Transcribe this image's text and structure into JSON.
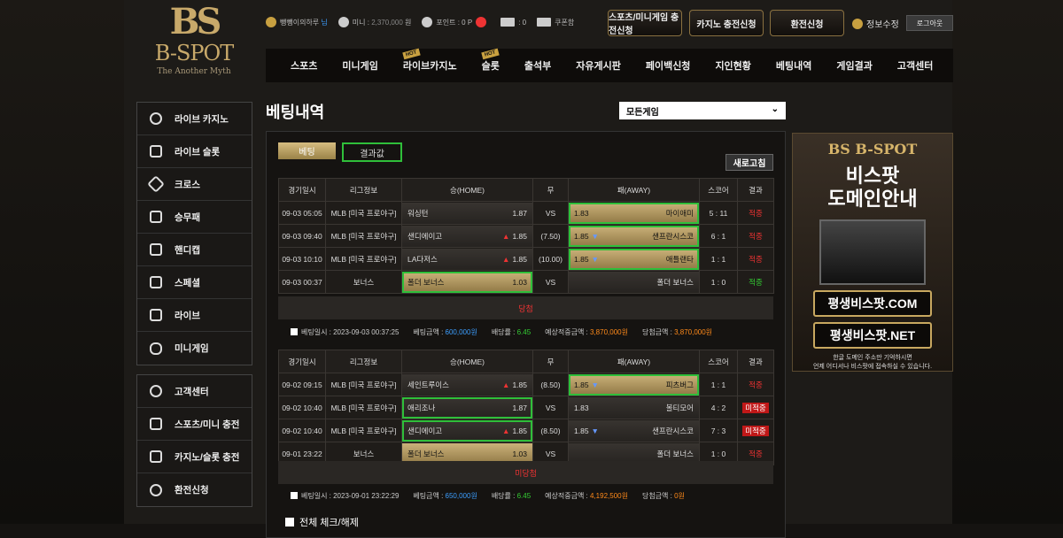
{
  "logo": {
    "mark": "BS",
    "name": "B-SPOT",
    "tagline": "The Another Myth"
  },
  "top": {
    "greet_name": "뺑뺑이의하루",
    "greet_suffix": "님",
    "mini_label": "미니 :",
    "mini_value": "2,370,000",
    "mini_unit": "원",
    "point_label": "포인트 :",
    "point_value": "0",
    "point_unit": "P",
    "msg_count": "0",
    "coupon": "쿠폰함",
    "btn1": "스포츠/미니게임 충전신청",
    "btn2": "카지노 충전신청",
    "btn3": "환전신청",
    "profile": "정보수정",
    "logout": "로그아웃"
  },
  "nav": [
    "스포츠",
    "미니게임",
    "라이브카지노",
    "슬롯",
    "출석부",
    "자유게시판",
    "페이백신청",
    "지인현황",
    "베팅내역",
    "게임결과",
    "고객센터"
  ],
  "nav_hot": "HOT",
  "sidebar1": [
    "라이브 카지노",
    "라이브 슬롯",
    "크로스",
    "승무패",
    "핸디캡",
    "스페셜",
    "라이브",
    "미니게임"
  ],
  "sidebar2": [
    "고객센터",
    "스포츠/미니 충전",
    "카지노/슬롯 충전",
    "환전신청"
  ],
  "title": "베팅내역",
  "game_select": "모든게임",
  "tabs": {
    "bet": "베팅",
    "result": "결과값",
    "refresh": "새로고침"
  },
  "headers": [
    "경기일시",
    "리그정보",
    "승(HOME)",
    "무",
    "패(AWAY)",
    "스코어",
    "결과"
  ],
  "slip1": {
    "rows": [
      {
        "date": "09-03 05:05",
        "league": "MLB [미국 프로야구]",
        "home": "워싱턴",
        "ho": "1.87",
        "mid": "VS",
        "ao": "1.83",
        "away": "마이애미",
        "score": "5 : 11",
        "res": "적중"
      },
      {
        "date": "09-03 09:40",
        "league": "MLB [미국 프로야구]",
        "home": "샌디에이고",
        "ho": "1.85",
        "mid": "(7.50)",
        "ao": "1.85",
        "away": "샌프란시스코",
        "score": "6 : 1",
        "res": "적중"
      },
      {
        "date": "09-03 10:10",
        "league": "MLB [미국 프로야구]",
        "home": "LA다저스",
        "ho": "1.85",
        "mid": "(10.00)",
        "ao": "1.85",
        "away": "애틀랜타",
        "score": "1 : 1",
        "res": "적중"
      },
      {
        "date": "09-03 00:37",
        "league": "보너스",
        "home": "폴더 보너스",
        "ho": "1.03",
        "mid": "VS",
        "ao": "",
        "away": "폴더 보너스",
        "score": "1 : 0",
        "res": "적중"
      }
    ],
    "status": "당첨",
    "time_label": "베팅일시 : 2023-09-03 00:37:25",
    "amt_label": "베팅금액 :",
    "amt": "600,000원",
    "odds_label": "배당률 :",
    "odds": "6.45",
    "exp_label": "예상적중금액 :",
    "exp": "3,870,000원",
    "win_label": "당첨금액 :",
    "win": "3,870,000원"
  },
  "slip2": {
    "rows": [
      {
        "date": "09-02 09:15",
        "league": "MLB [미국 프로야구]",
        "home": "세인트루이스",
        "ho": "1.85",
        "mid": "(8.50)",
        "ao": "1.85",
        "away": "피츠버그",
        "score": "1 : 1",
        "res": "적중"
      },
      {
        "date": "09-02 10:40",
        "league": "MLB [미국 프로야구]",
        "home": "애리조나",
        "ho": "1.87",
        "mid": "VS",
        "ao": "1.83",
        "away": "볼티모어",
        "score": "4 : 2",
        "res": "미적중"
      },
      {
        "date": "09-02 10:40",
        "league": "MLB [미국 프로야구]",
        "home": "샌디에이고",
        "ho": "1.85",
        "mid": "(8.50)",
        "ao": "1.85",
        "away": "샌프란시스코",
        "score": "7 : 3",
        "res": "미적중"
      },
      {
        "date": "09-01 23:22",
        "league": "보너스",
        "home": "폴더 보너스",
        "ho": "1.03",
        "mid": "VS",
        "ao": "",
        "away": "폴더 보너스",
        "score": "1 : 0",
        "res": "적중"
      }
    ],
    "status": "미당첨",
    "time_label": "베팅일시 : 2023-09-01 23:22:29",
    "amt_label": "베팅금액 :",
    "amt": "650,000원",
    "odds_label": "배당률 :",
    "odds": "6.45",
    "exp_label": "예상적중금액 :",
    "exp": "4,192,500원",
    "win_label": "당첨금액 :",
    "win": "0원"
  },
  "check_all": "전체 체크/해제",
  "ad": {
    "logo": "BS B-SPOT",
    "headline1": "비스팟",
    "headline2": "도메인안내",
    "btn1": "평생비스팟.COM",
    "btn2": "평생비스팟.NET",
    "note1": "한글 도메인 주소만 기억하시면",
    "note2": "언제 어디서나 비스팟에 접속하실 수 있습니다."
  }
}
